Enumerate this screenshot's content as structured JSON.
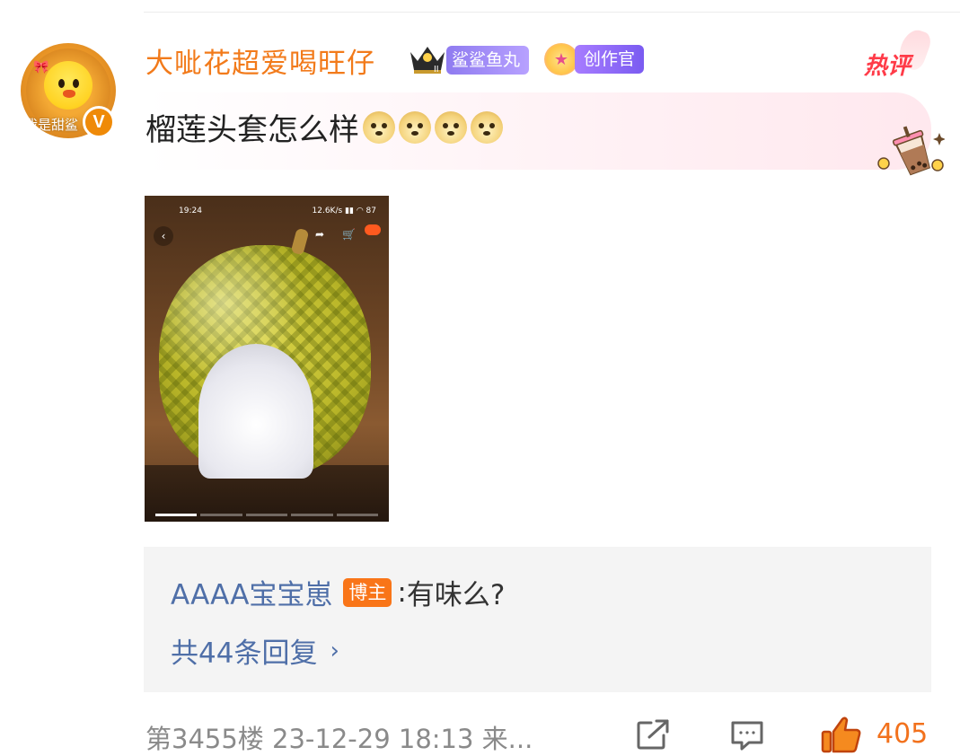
{
  "comment": {
    "username": "大呲花超爱喝旺仔",
    "avatar_caption": "我是甜鲨",
    "verified_mark": "V",
    "badges": {
      "fan_badge_label": "鲨鲨鱼丸",
      "creator_badge_label": "创作官"
    },
    "hot_tag": "热评",
    "text": "榴莲头套怎么样",
    "emoji_name": "doge-emoji",
    "emoji_count": 4
  },
  "photo": {
    "status_time": "19:24",
    "status_network": "12.6K/s",
    "status_battery": "87"
  },
  "reply": {
    "user": "AAAA宝宝崽",
    "tag": "博主",
    "separator": ":",
    "text": "有味么?",
    "count_text": "共44条回复"
  },
  "footer": {
    "meta_text": "第3455楼 23-12-29 18:13 来...",
    "like_count": "405"
  },
  "colors": {
    "username": "#f27a1a",
    "link_blue": "#4f6fa8",
    "hot_red": "#ff3b48",
    "like_orange": "#f2711c",
    "reply_bg": "#f4f4f4"
  }
}
